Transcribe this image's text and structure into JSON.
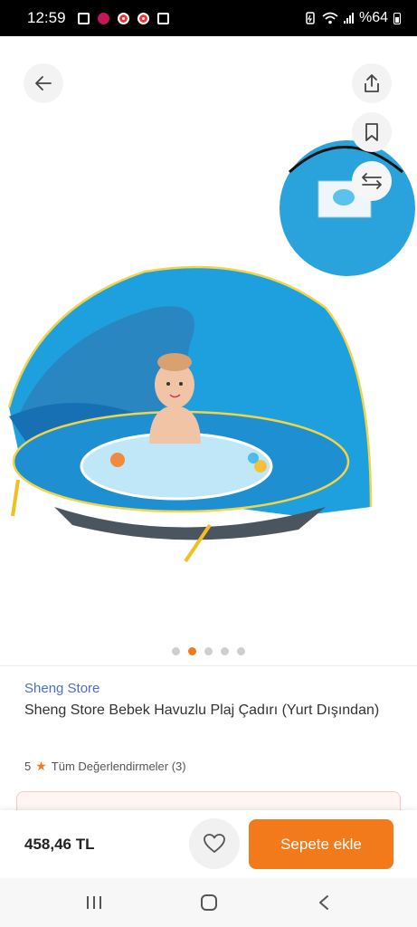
{
  "status_bar": {
    "time": "12:59",
    "battery": "%64"
  },
  "product": {
    "store_name": "Sheng Store",
    "title": "Sheng Store Bebek Havuzlu Plaj Çadırı (Yurt Dışından)",
    "rating_value": "5",
    "reviews_label": "Tüm Değerlendirmeler (3)",
    "price": "458,46 TL"
  },
  "gallery": {
    "image_count": 5,
    "active_index": 2
  },
  "actions": {
    "add_to_cart_label": "Sepete ekle"
  },
  "colors": {
    "accent": "#f27a1a",
    "store_link": "#4a6fd1"
  },
  "icons": {
    "back": "arrow-left-icon",
    "share": "share-icon",
    "bookmark": "bookmark-icon",
    "compare": "swap-arrows-icon",
    "favorite": "heart-icon",
    "rating": "star-icon"
  }
}
